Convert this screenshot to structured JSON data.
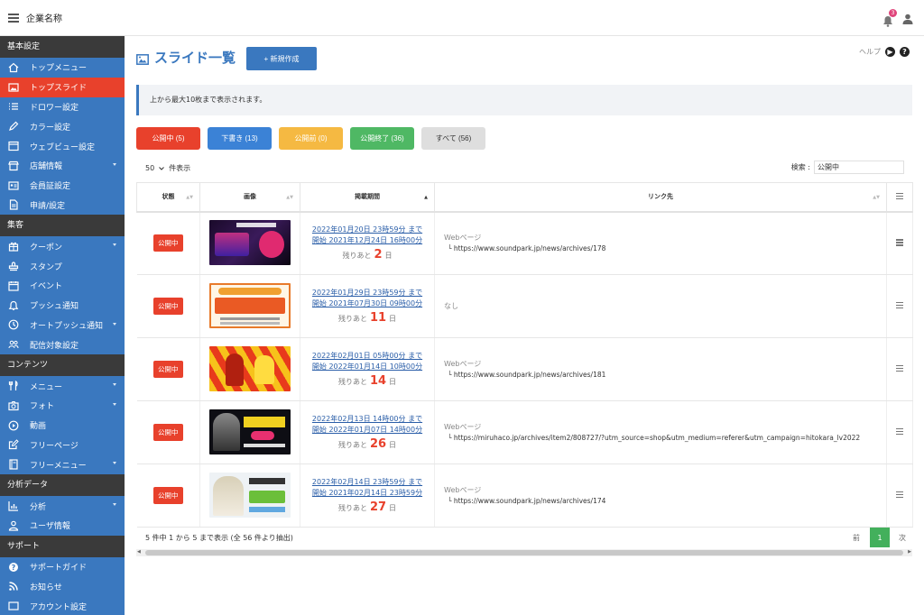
{
  "header": {
    "company": "企業名称",
    "notification_count": "3"
  },
  "sidebar": {
    "sections": [
      {
        "title": "基本設定",
        "items": [
          {
            "label": "トップメニュー",
            "icon": "home-icon"
          },
          {
            "label": "トップスライド",
            "icon": "image-icon",
            "active": true
          },
          {
            "label": "ドロワー設定",
            "icon": "list-icon"
          },
          {
            "label": "カラー設定",
            "icon": "pen-icon"
          },
          {
            "label": "ウェブビュー設定",
            "icon": "window-icon"
          },
          {
            "label": "店舗情報",
            "icon": "store-icon",
            "caret": true
          },
          {
            "label": "会員証設定",
            "icon": "id-card-icon"
          },
          {
            "label": "申請/設定",
            "icon": "file-icon"
          }
        ]
      },
      {
        "title": "集客",
        "items": [
          {
            "label": "クーポン",
            "icon": "gift-icon",
            "caret": true
          },
          {
            "label": "スタンプ",
            "icon": "stamp-icon"
          },
          {
            "label": "イベント",
            "icon": "calendar-icon"
          },
          {
            "label": "プッシュ通知",
            "icon": "bell-icon"
          },
          {
            "label": "オートプッシュ通知",
            "icon": "clock-icon",
            "caret": true
          },
          {
            "label": "配信対象設定",
            "icon": "users-icon"
          }
        ]
      },
      {
        "title": "コンテンツ",
        "items": [
          {
            "label": "メニュー",
            "icon": "utensils-icon",
            "caret": true
          },
          {
            "label": "フォト",
            "icon": "camera-icon",
            "caret": true
          },
          {
            "label": "動画",
            "icon": "play-icon"
          },
          {
            "label": "フリーページ",
            "icon": "edit-icon"
          },
          {
            "label": "フリーメニュー",
            "icon": "book-icon",
            "caret": true
          }
        ]
      },
      {
        "title": "分析データ",
        "items": [
          {
            "label": "分析",
            "icon": "chart-icon",
            "caret": true
          },
          {
            "label": "ユーザ情報",
            "icon": "user-icon"
          }
        ]
      },
      {
        "title": "サポート",
        "items": [
          {
            "label": "サポートガイド",
            "icon": "question-icon"
          },
          {
            "label": "お知らせ",
            "icon": "rss-icon"
          },
          {
            "label": "アカウント設定",
            "icon": "account-icon"
          }
        ]
      }
    ]
  },
  "main": {
    "title": "スライド一覧",
    "new_button": "+ 新規作成",
    "help": "ヘルプ",
    "notice": "上から最大10枚まで表示されます。",
    "filters": [
      {
        "label": "公開中 (5)",
        "color": "#e8412c"
      },
      {
        "label": "下書き (13)",
        "color": "#3b82d6"
      },
      {
        "label": "公開前 (0)",
        "color": "#f5b942"
      },
      {
        "label": "公開終了 (36)",
        "color": "#4fb864"
      },
      {
        "label": "すべて (56)",
        "color": "#dedede",
        "text_color": "#333"
      }
    ],
    "length": {
      "value": "50",
      "label": "件表示"
    },
    "search": {
      "label": "検索 :",
      "value": "公開中"
    },
    "columns": [
      "状態",
      "画像",
      "掲載期間",
      "リンク先",
      ""
    ],
    "rows": [
      {
        "status": "公開中",
        "image": "livedam",
        "end": "2022年01月20日 23時59分 まで",
        "start": "開始 2021年12月24日 16時00分",
        "remain_pre": "残りあと",
        "remain": "2",
        "remain_post": "日",
        "link_type": "Webページ",
        "link_url": "└ https://www.soundpark.jp/news/archives/178"
      },
      {
        "status": "公開中",
        "image": "nexpay",
        "end": "2022年01月29日 23時59分 まで",
        "start": "開始 2021年07月30日 09時00分",
        "remain_pre": "残りあと",
        "remain": "11",
        "remain_post": "日",
        "link_type": "",
        "link_url": "",
        "link_none": "なし"
      },
      {
        "status": "公開中",
        "image": "newyear",
        "end": "2022年02月01日 05時00分 まで",
        "start": "開始 2022年01月14日 10時00分",
        "remain_pre": "残りあと",
        "remain": "14",
        "remain_post": "日",
        "link_type": "Webページ",
        "link_url": "└ https://www.soundpark.jp/news/archives/181"
      },
      {
        "status": "公開中",
        "image": "hitokara",
        "end": "2022年02月13日 14時00分 まで",
        "start": "開始 2022年01月07日 14時00分",
        "remain_pre": "残りあと",
        "remain": "26",
        "remain_post": "日",
        "link_type": "Webページ",
        "link_url": "└ https://miruhaco.jp/archives/item2/808727/?utm_source=shop&utm_medium=referer&utm_campaign=hitokara_lv2022"
      },
      {
        "status": "公開中",
        "image": "koda",
        "end": "2022年02月14日 23時59分 まで",
        "start": "開始 2021年02月14日 23時59分",
        "remain_pre": "残りあと",
        "remain": "27",
        "remain_post": "日",
        "link_type": "Webページ",
        "link_url": "└ https://www.soundpark.jp/news/archives/174"
      }
    ],
    "info": "5 件中 1 から 5 まで表示 (全 56 件より抽出)",
    "pager": {
      "prev": "前",
      "current": "1",
      "next": "次"
    }
  }
}
